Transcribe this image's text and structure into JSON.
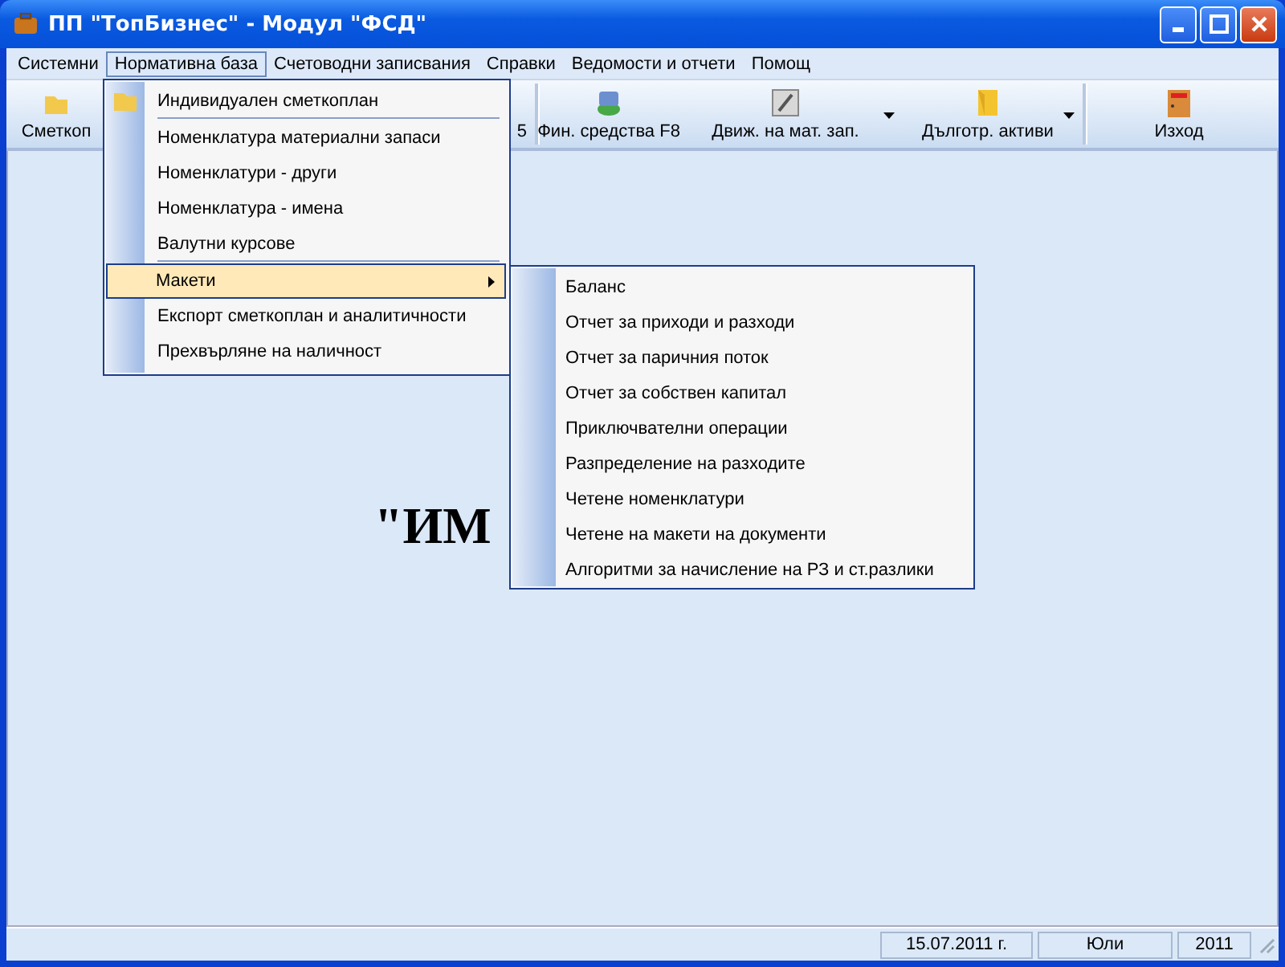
{
  "window": {
    "title": "ПП \"ТопБизнес\" - Модул \"ФСД\""
  },
  "menu_bar": [
    {
      "label": "Системни",
      "selected": false
    },
    {
      "label": "Нормативна база",
      "selected": true
    },
    {
      "label": "Счетоводни записвания",
      "selected": false
    },
    {
      "label": "Справки",
      "selected": false
    },
    {
      "label": "Ведомости и отчети",
      "selected": false
    },
    {
      "label": "Помощ",
      "selected": false
    }
  ],
  "toolbar": [
    {
      "label": "Сметкоп",
      "dropdown": false
    },
    {
      "label": "5",
      "dropdown": false
    },
    {
      "label": "Фин. средства F8",
      "dropdown": false
    },
    {
      "label": "Движ. на мат. зап.",
      "dropdown": true
    },
    {
      "label": "Дълготр. активи",
      "dropdown": true
    },
    {
      "label": "Изход",
      "dropdown": false
    }
  ],
  "canvas_text": "\"ИМ",
  "menu": [
    {
      "label": "Индивидуален сметкоплан",
      "selected": false,
      "submenu": false,
      "separator_after": true
    },
    {
      "label": "Номенклатура материални запаси",
      "selected": false,
      "submenu": false,
      "separator_after": false
    },
    {
      "label": "Номенклатури - други",
      "selected": false,
      "submenu": false,
      "separator_after": false
    },
    {
      "label": "Номенклатура - имена",
      "selected": false,
      "submenu": false,
      "separator_after": false
    },
    {
      "label": "Валутни курсове",
      "selected": false,
      "submenu": false,
      "separator_after": true
    },
    {
      "label": "Макети",
      "selected": true,
      "submenu": true,
      "separator_after": false
    },
    {
      "label": "Експорт сметкоплан и аналитичности",
      "selected": false,
      "submenu": false,
      "separator_after": false
    },
    {
      "label": "Прехвърляне на наличност",
      "selected": false,
      "submenu": false,
      "separator_after": false
    }
  ],
  "submenu": [
    "Баланс",
    "Отчет за приходи и разходи",
    "Отчет за паричния поток",
    "Отчет за собствен капитал",
    "Приключвателни операции",
    "Разпределение на разходите",
    "Четене номенклатури",
    "Четене на макети на документи",
    "Алгоритми за начисление на РЗ и ст.разлики"
  ],
  "status_bar": [
    "15.07.2011 г.",
    "Юли",
    "2011"
  ]
}
